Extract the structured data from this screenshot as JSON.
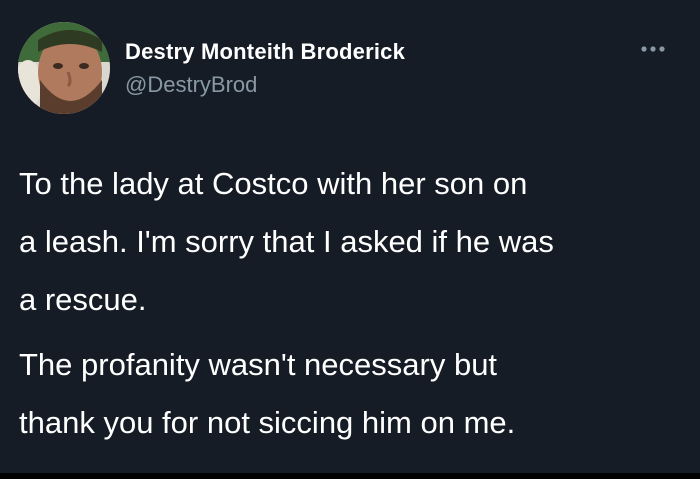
{
  "author": {
    "display_name": "Destry Monteith Broderick",
    "handle": "@DestryBrod",
    "avatar_icon": "profile-photo"
  },
  "menu": {
    "icon": "more-horizontal-icon"
  },
  "tweet": {
    "lines": [
      "To the lady at Costco with her son on",
      "a leash. I'm sorry that I asked if he was",
      "a rescue.",
      "The profanity wasn't necessary but",
      "thank you for not siccing him on me."
    ]
  },
  "colors": {
    "background": "#161c25",
    "text_primary": "#ffffff",
    "text_secondary": "#8899a6"
  }
}
